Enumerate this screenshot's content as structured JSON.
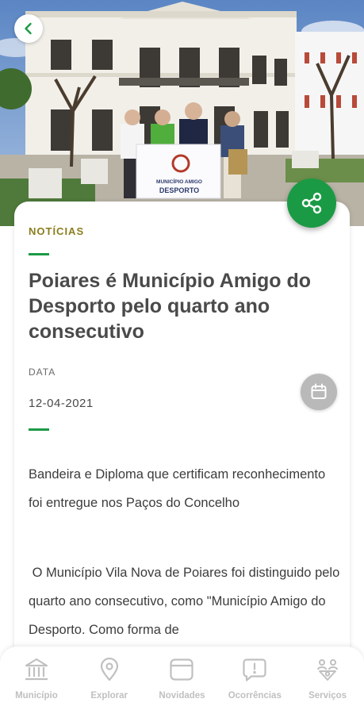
{
  "hero": {
    "banner_line1": "MUNICÍPIO AMIGO",
    "banner_line2": "DESPORTO"
  },
  "article": {
    "category": "NOTÍCIAS",
    "title": "Poiares é Município Amigo do Desporto pelo quarto ano consecutivo",
    "date_label": "DATA",
    "date_value": "12-04-2021",
    "paragraph1": "Bandeira e Diploma que certificam reconhecimento foi entregue nos Paços do Concelho",
    "paragraph2": " O Município Vila Nova de Poiares foi distinguido pelo quarto ano consecutivo, como \"Município Amigo do Desporto. Como forma de"
  },
  "nav": {
    "items": [
      {
        "label": "Município",
        "icon": "building-icon"
      },
      {
        "label": "Explorar",
        "icon": "map-pin-icon"
      },
      {
        "label": "Novidades",
        "icon": "news-icon"
      },
      {
        "label": "Ocorrências",
        "icon": "alert-message-icon"
      },
      {
        "label": "Serviços",
        "icon": "services-icon"
      }
    ]
  },
  "colors": {
    "accent": "#1b9a45",
    "category": "#8a7d1d",
    "inactive": "#c0c0c0"
  }
}
